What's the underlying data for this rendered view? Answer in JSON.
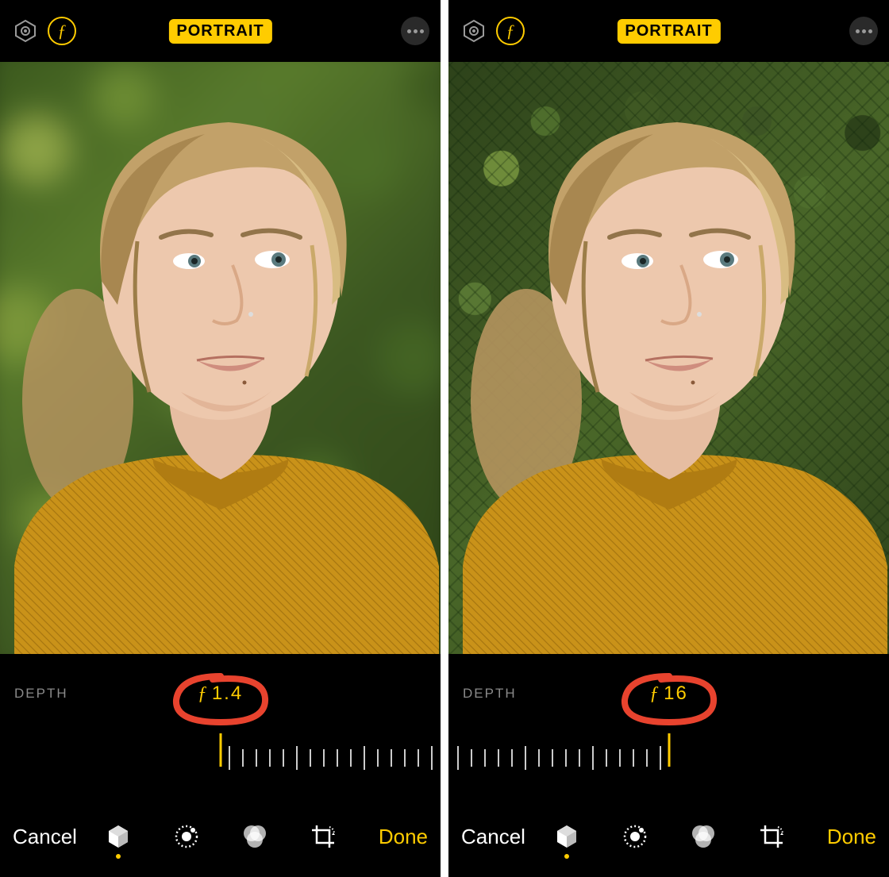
{
  "panes": [
    {
      "mode": "PORTRAIT",
      "depth": {
        "label": "DEPTH",
        "f_prefix": "ƒ",
        "f_value": "1.4"
      },
      "slider_align": "right",
      "annotation": {
        "circle_color": "#e8432e"
      },
      "bottom": {
        "cancel": "Cancel",
        "done": "Done",
        "active_tool_index": 0
      },
      "blur": "strong"
    },
    {
      "mode": "PORTRAIT",
      "depth": {
        "label": "DEPTH",
        "f_prefix": "ƒ",
        "f_value": "16"
      },
      "slider_align": "left",
      "annotation": {
        "circle_color": "#e8432e"
      },
      "bottom": {
        "cancel": "Cancel",
        "done": "Done",
        "active_tool_index": 0
      },
      "blur": "none"
    }
  ],
  "icons": {
    "hex": "hexagon-aperture-icon",
    "fstop": "f-stop-icon",
    "more": "more-icon",
    "lighting": "cube-lighting-icon",
    "adjust": "adjust-dial-icon",
    "filters": "filters-circles-icon",
    "crop": "crop-rotate-icon"
  },
  "colors": {
    "accent": "#ffcc00",
    "annotation": "#e8432e"
  }
}
